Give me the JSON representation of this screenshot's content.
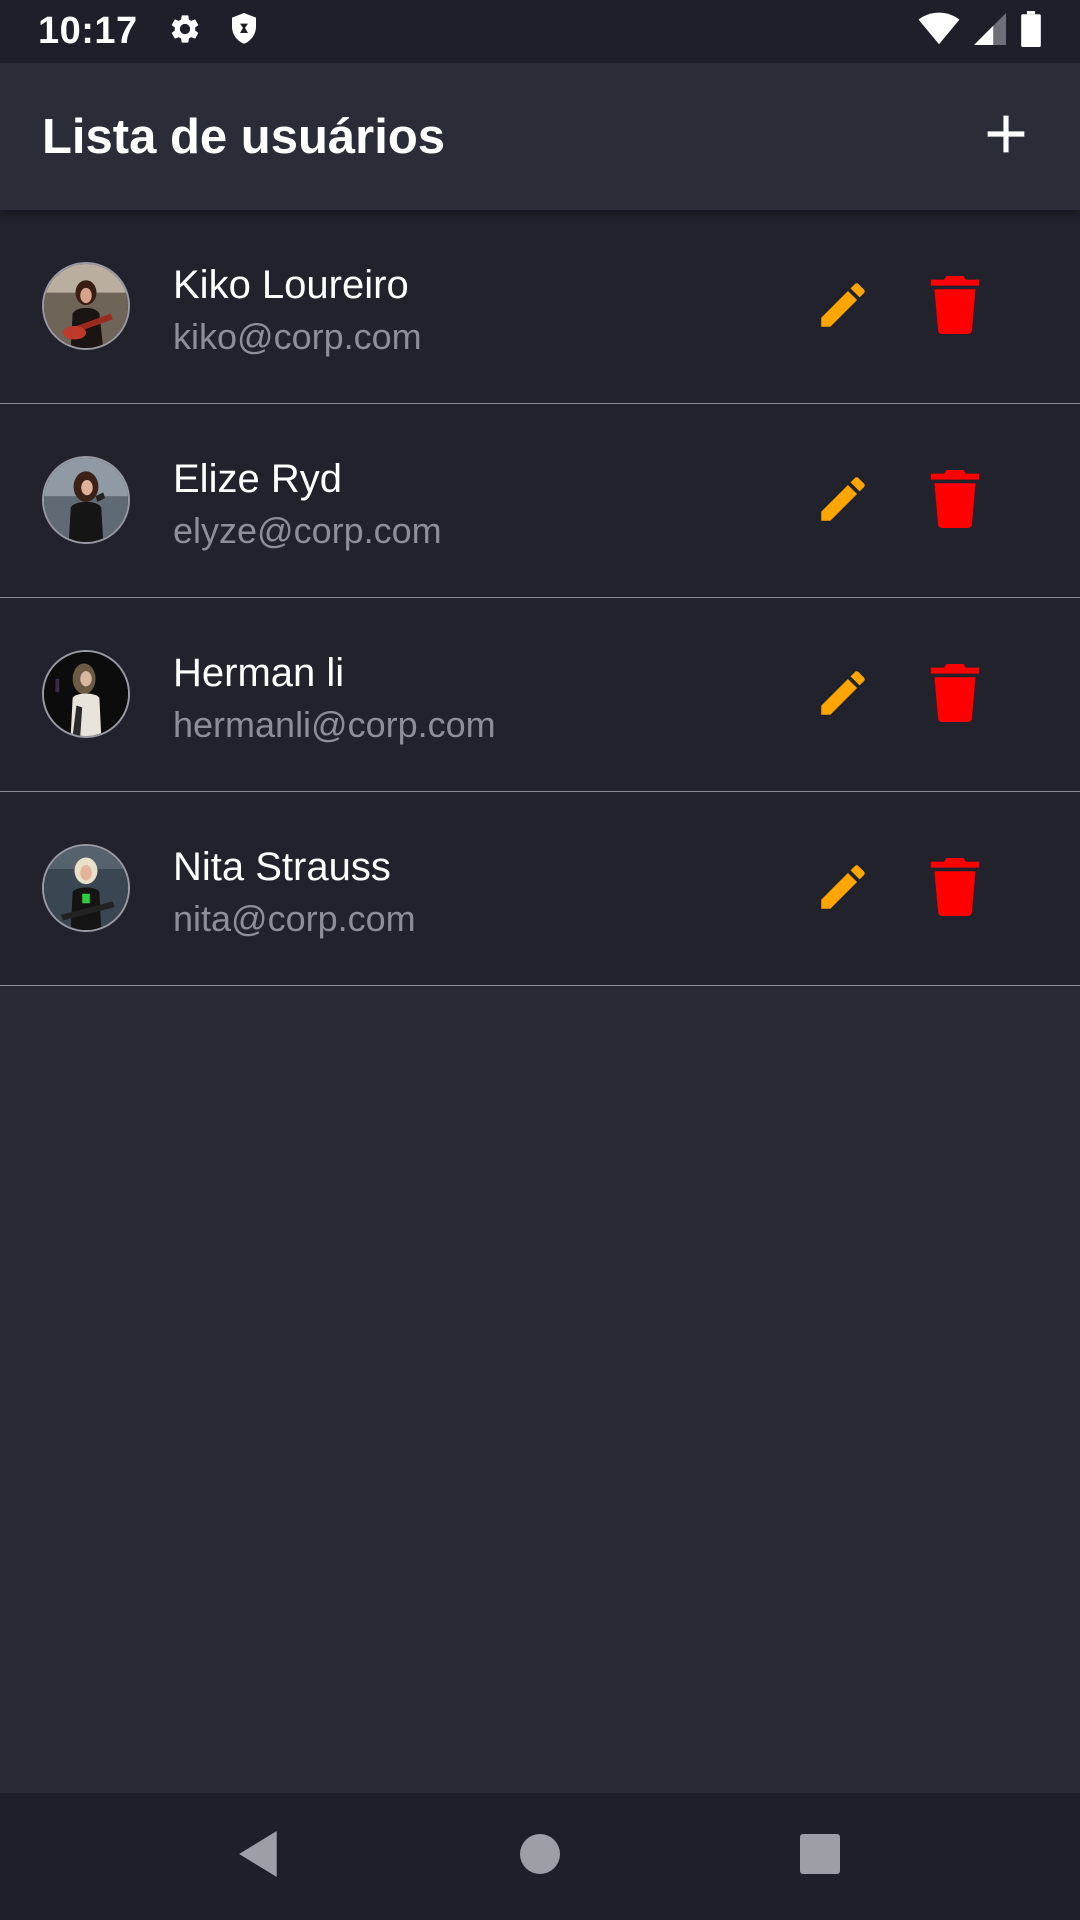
{
  "status_bar": {
    "time": "10:17",
    "left_icons": [
      "settings-icon",
      "shield-icon"
    ],
    "right_icons": [
      "wifi-icon",
      "signal-icon",
      "battery-icon"
    ]
  },
  "app_bar": {
    "title": "Lista de usuários",
    "action_icon": "add-icon"
  },
  "users": [
    {
      "name": "Kiko Loureiro",
      "email": "kiko@corp.com",
      "avatar_icon": "avatar-photo"
    },
    {
      "name": "Elize Ryd",
      "email": "elyze@corp.com",
      "avatar_icon": "avatar-photo"
    },
    {
      "name": "Herman li",
      "email": "hermanli@corp.com",
      "avatar_icon": "avatar-photo"
    },
    {
      "name": "Nita Strauss",
      "email": "nita@corp.com",
      "avatar_icon": "avatar-photo"
    }
  ],
  "row_actions": {
    "edit_icon": "pencil-icon",
    "delete_icon": "trash-icon"
  },
  "colors": {
    "background": "#282a36",
    "app_bar": "#2a2c37",
    "row_background": "#21222c",
    "system_bars": "#1e1f29",
    "edit_accent": "#ffa500",
    "delete_accent": "#ff0000",
    "secondary_text": "#8d8e96",
    "divider": "#8a8c96"
  },
  "nav_bar": {
    "buttons": [
      "back-icon",
      "home-icon",
      "recents-icon"
    ]
  }
}
